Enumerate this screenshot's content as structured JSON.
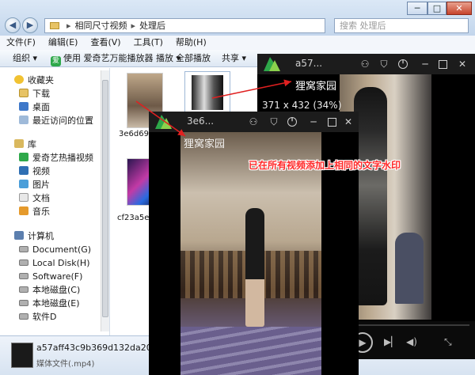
{
  "explorer": {
    "address": [
      "相同尺寸视频",
      "处理后"
    ],
    "search_placeholder": "搜索 处理后",
    "window_controls": [
      "─",
      "□",
      "✕"
    ],
    "menu": [
      "文件(F)",
      "编辑(E)",
      "查看(V)",
      "工具(T)",
      "帮助(H)"
    ],
    "toolbar": {
      "organize": "组织",
      "play_with": "使用 爱奇艺万能播放器 播放",
      "play_all": "全部播放",
      "share": "共享"
    },
    "sidebar": {
      "favorites": "收藏夹",
      "fav_items": [
        "下载",
        "桌面",
        "最近访问的位置"
      ],
      "libraries": "库",
      "lib_items": [
        "爱奇艺热播视频",
        "视频",
        "图片",
        "文档",
        "音乐"
      ],
      "computer": "计算机",
      "drives": [
        "Document(G)",
        "Local Disk(H)",
        "Software(F)",
        "本地磁盘(C)",
        "本地磁盘(E)",
        "软件D"
      ]
    },
    "files": [
      "3e6d694",
      "cf23a5e0"
    ],
    "details": {
      "filename": "a57aff43c9b369d132da2028f6",
      "filetype": "媒体文件(.mp4)"
    }
  },
  "player_back": {
    "title": "a57...",
    "watermark": "狸窝家园",
    "dimensions": "371 x 432 (34%)"
  },
  "player_front": {
    "title": "3e6...",
    "watermark": "狸窝家园"
  },
  "annotation": "已在所有视频添加上相同的文字水印",
  "colors": {
    "annotation": "#ff2a2a",
    "player_bg": "#000000",
    "iqiyi_green": "#2ea84a"
  }
}
